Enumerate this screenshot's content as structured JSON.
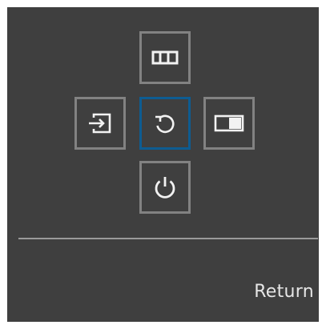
{
  "menu": {
    "buttons": [
      {
        "id": "picture-mode",
        "icon": "picture-mode-icon",
        "selected": false
      },
      {
        "id": "source",
        "icon": "source-input-icon",
        "selected": false
      },
      {
        "id": "return",
        "icon": "return-icon",
        "selected": true
      },
      {
        "id": "pip-pbp",
        "icon": "pip-pbp-icon",
        "selected": false
      },
      {
        "id": "power",
        "icon": "power-icon",
        "selected": false
      }
    ],
    "selection_color": "#0d5c92",
    "border_color": "#828282"
  },
  "footer": {
    "label": "Return"
  }
}
